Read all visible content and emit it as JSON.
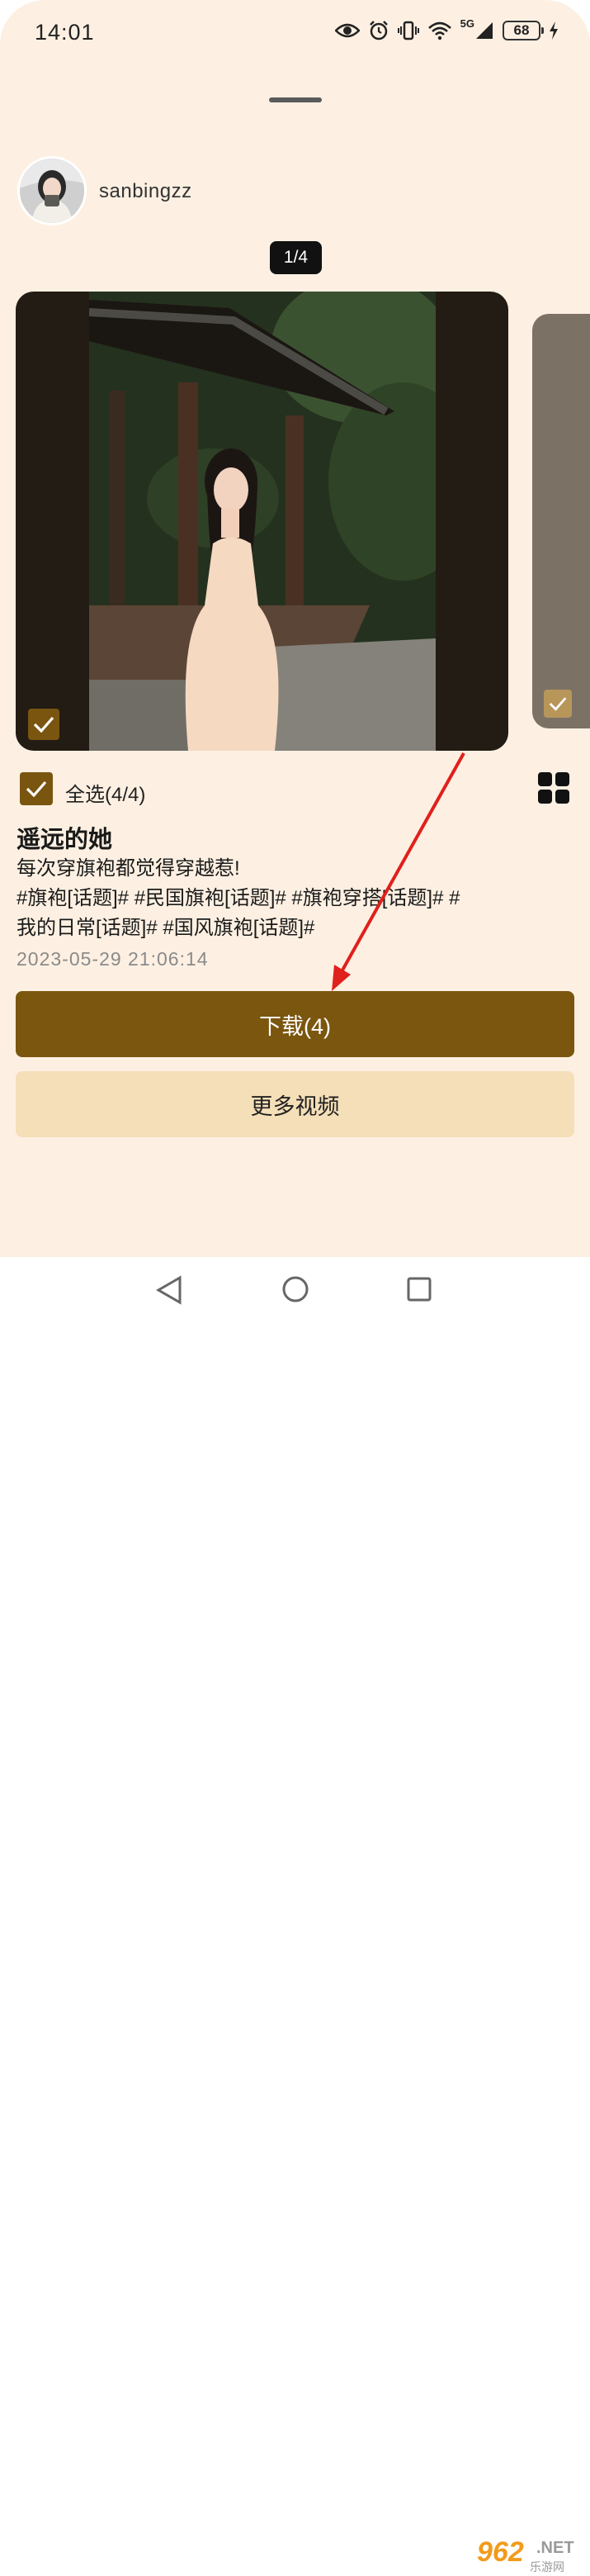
{
  "status_bar": {
    "time": "14:01",
    "battery": "68",
    "network": "5G",
    "icons": [
      "eye-icon",
      "alarm-icon",
      "vibrate-icon",
      "wifi-icon",
      "signal-icon",
      "battery-icon",
      "charging-icon"
    ]
  },
  "post": {
    "username": "sanbingzz",
    "counter": "1/4",
    "select_all": "全选(4/4)",
    "title": "遥远的她",
    "body_lines": [
      "每次穿旗袍都觉得穿越惹!",
      "#旗袍[话题]# #民国旗袍[话题]# #旗袍穿搭[话题]# #",
      "我的日常[话题]# #国风旗袍[话题]#"
    ],
    "timestamp": "2023-05-29 21:06:14"
  },
  "actions": {
    "download_label": "下载(4)",
    "more_videos_label": "更多视频"
  },
  "watermark": {
    "mark": "962",
    "net": ".NET",
    "site": "乐游网"
  },
  "colors": {
    "sheet_bg": "#fdf0e2",
    "accent": "#7b560f",
    "secondary_button": "#f5dfb8"
  }
}
